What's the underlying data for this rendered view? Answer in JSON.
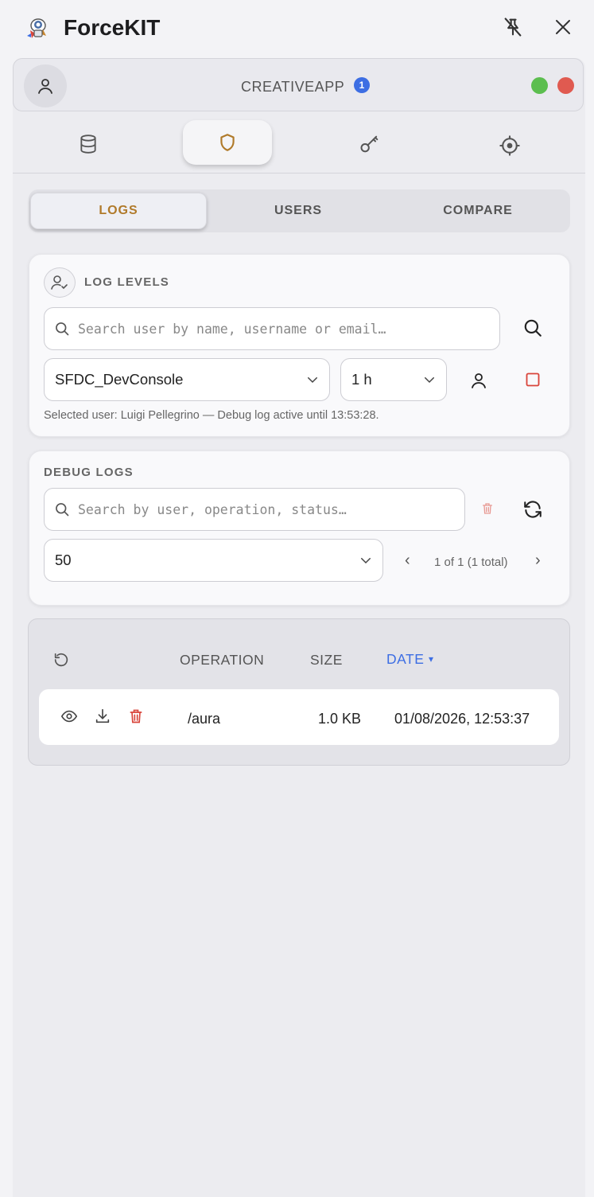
{
  "app": {
    "title": "ForceKIT"
  },
  "org": {
    "name": "CREATIVEAPP",
    "badge_count": "1"
  },
  "tabs": [
    "LOGS",
    "USERS",
    "COMPARE"
  ],
  "log_levels": {
    "title": "LOG LEVELS",
    "search_placeholder": "Search user by name, username or email…",
    "trace_flag": "SFDC_DevConsole",
    "duration": "1 h",
    "hint": "Selected user: Luigi Pellegrino — Debug log active until 13:53:28."
  },
  "debug_logs": {
    "title": "DEBUG LOGS",
    "search_placeholder": "Search by user, operation, status…",
    "page_size": "50",
    "pagination": "1 of 1 (1 total)",
    "prev": "‹",
    "next": "›"
  },
  "table": {
    "columns": {
      "operation": "OPERATION",
      "size": "SIZE",
      "date": "DATE",
      "sort_indicator": "▾"
    },
    "rows": [
      {
        "operation": "/aura",
        "size": "1.0 KB",
        "date": "01/08/2026, 12:53:37"
      }
    ]
  },
  "colors": {
    "accent_gold": "#b07a2a",
    "accent_blue": "#3d6ee3",
    "status_green": "#5cbe4f",
    "status_red": "#e05a50",
    "danger": "#d9453b"
  }
}
